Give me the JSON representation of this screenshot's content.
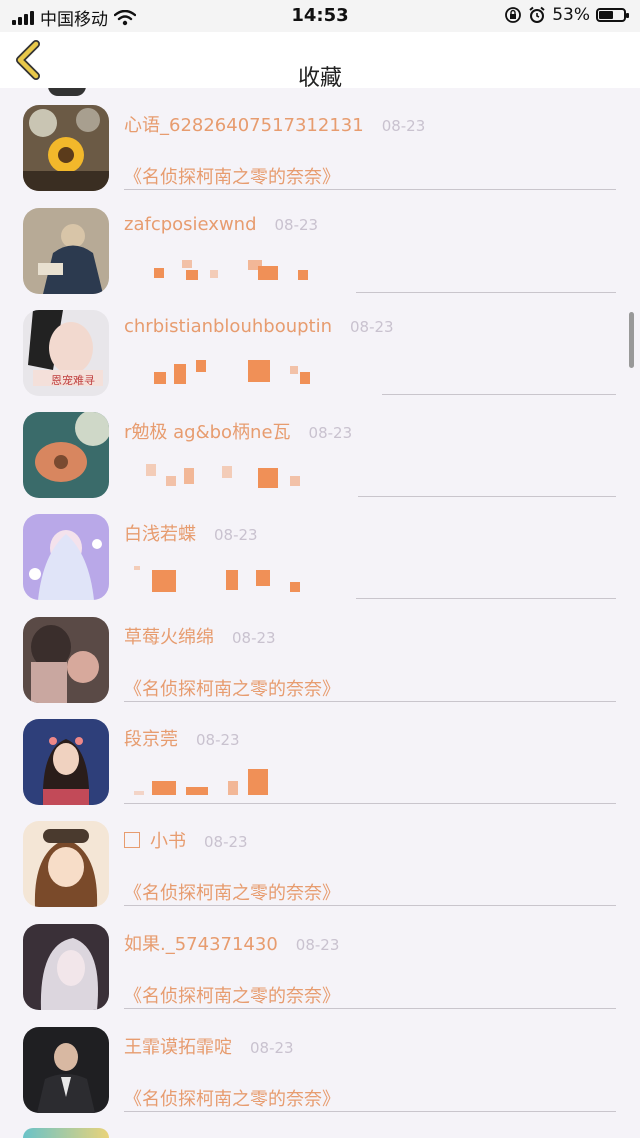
{
  "status_bar": {
    "carrier": "中国移动",
    "time": "14:53",
    "battery": "53%",
    "battery_level": 0.53,
    "icons": [
      "signal-icon",
      "wifi-icon",
      "rotation-lock-icon",
      "alarm-icon",
      "battery-icon"
    ]
  },
  "nav": {
    "back_icon": "chevron-left-icon",
    "title": "收藏",
    "accent": "#e8c84a"
  },
  "colors": {
    "name_text": "#e79c6f",
    "date_text": "#c9c2cf",
    "background": "#f5f3f8",
    "divider": "#c9c5cc"
  },
  "items": [
    {
      "name": "心语_62826407517312131",
      "date": "08-23",
      "message": "《名侦探柯南之零的奈奈》"
    },
    {
      "name": "zafcposiexwnd",
      "date": "08-23",
      "message": ""
    },
    {
      "name": "chrbistianblouhbouptin",
      "date": "08-23",
      "message": ""
    },
    {
      "name": "r勉极 ag&bo柄ne瓦",
      "date": "08-23",
      "message": ""
    },
    {
      "name": "白浅若蝶",
      "date": "08-23",
      "message": ""
    },
    {
      "name": "草莓火绵绵",
      "date": "08-23",
      "message": "《名侦探柯南之零的奈奈》"
    },
    {
      "name": "段京莞",
      "date": "08-23",
      "message": ""
    },
    {
      "name": "小书",
      "date": "08-23",
      "message": "《名侦探柯南之零的奈奈》"
    },
    {
      "name": "如果._574371430",
      "date": "08-23",
      "message": "《名侦探柯南之零的奈奈》"
    },
    {
      "name": "王霏谟拓霏啶",
      "date": "08-23",
      "message": "《名侦探柯南之零的奈奈》"
    }
  ]
}
